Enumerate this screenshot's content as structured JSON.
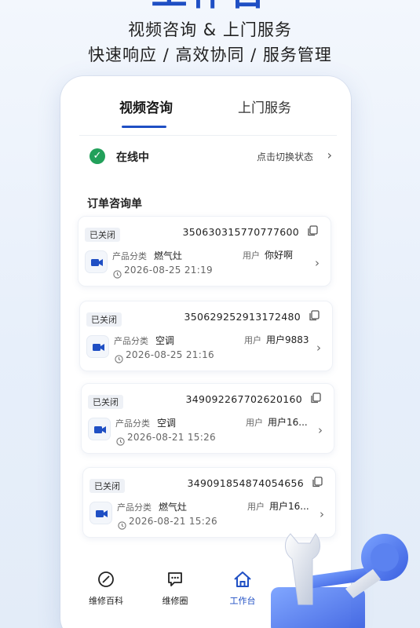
{
  "hero": {
    "title": "工作台",
    "subtitle1": "视频咨询 & 上门服务",
    "subtitle2": "快速响应 / 高效协同 / 服务管理"
  },
  "tabs": [
    {
      "label": "视频咨询",
      "active": true
    },
    {
      "label": "上门服务",
      "active": false
    }
  ],
  "status": {
    "icon": "check-circle-icon",
    "text": "在线中",
    "switch_label": "点击切换状态"
  },
  "section_title": "订单咨询单",
  "orders": [
    {
      "badge": "已关闭",
      "order_no": "350630315770777600",
      "category_label": "产品分类",
      "category": "燃气灶",
      "user_label": "用户",
      "user": "你好啊",
      "time": "2026-08-25 21:19"
    },
    {
      "badge": "已关闭",
      "order_no": "350629252913172480",
      "category_label": "产品分类",
      "category": "空调",
      "user_label": "用户",
      "user": "用户9883",
      "time": "2026-08-25 21:16"
    },
    {
      "badge": "已关闭",
      "order_no": "349092267702620160",
      "category_label": "产品分类",
      "category": "空调",
      "user_label": "用户",
      "user": "用户16...",
      "time": "2026-08-21 15:26"
    },
    {
      "badge": "已关闭",
      "order_no": "349091854874054656",
      "category_label": "产品分类",
      "category": "燃气灶",
      "user_label": "用户",
      "user": "用户16...",
      "time": "2026-08-21 15:26"
    }
  ],
  "nav": [
    {
      "label": "维修百科",
      "icon": "compass-icon",
      "active": false
    },
    {
      "label": "维修圈",
      "icon": "chat-bubble-icon",
      "active": false
    },
    {
      "label": "工作台",
      "icon": "home-icon",
      "active": true
    }
  ],
  "colors": {
    "accent": "#1f4fc4",
    "online": "#22a05a"
  }
}
